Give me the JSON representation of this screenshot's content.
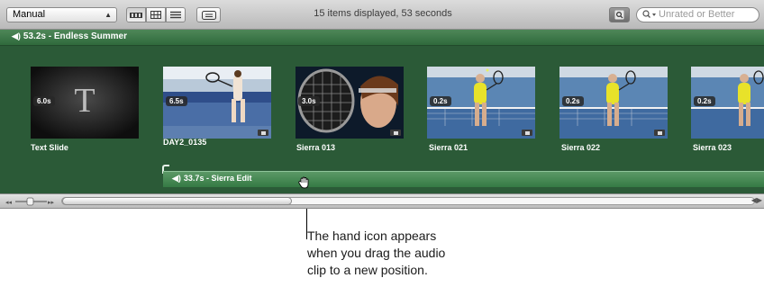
{
  "toolbar": {
    "sort_value": "Manual",
    "status": "15 items displayed, 53 seconds",
    "filter_value": "Unrated or Better"
  },
  "event": {
    "title": "53.2s - Endless Summer",
    "clips": [
      {
        "name": "Text Slide",
        "duration": "6.0s",
        "thumb": "text-slide",
        "slide_letter": "T"
      },
      {
        "name": "DAY2_0135",
        "duration": "6.5s",
        "thumb": "tennis-court"
      },
      {
        "name": "Sierra 013",
        "duration": "3.0s",
        "thumb": "racket-closeup"
      },
      {
        "name": "Sierra 021",
        "duration": "0.2s",
        "thumb": "tennis-player"
      },
      {
        "name": "Sierra 022",
        "duration": "0.2s",
        "thumb": "tennis-player"
      },
      {
        "name": "Sierra 023",
        "duration": "0.2s",
        "thumb": "tennis-player"
      }
    ],
    "audio_clip": "33.7s - Sierra Edit"
  },
  "callout": {
    "lines": [
      "The hand icon appears",
      "when you drag the audio",
      "clip to a new position."
    ]
  },
  "colors": {
    "event_bg": "#2b5a37",
    "audio_clip": "#4a8a55"
  },
  "icons": [
    "speaker-icon",
    "hand-cursor-icon",
    "video-camera-icon",
    "magnifier-icon"
  ]
}
